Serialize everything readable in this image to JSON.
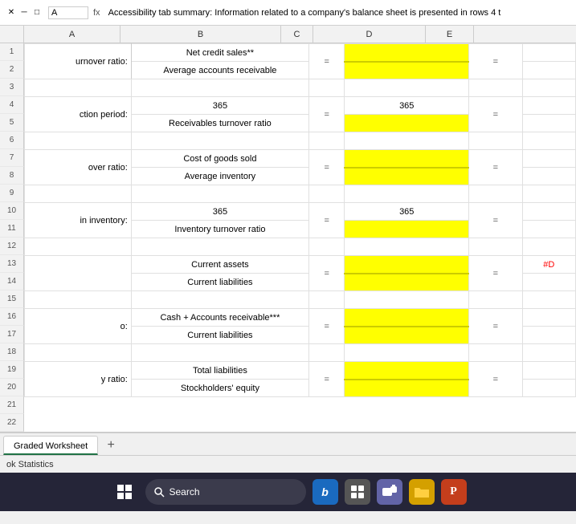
{
  "titlebar": {
    "close_btn": "✕",
    "min_btn": "─",
    "max_btn": "□",
    "name_box": "A",
    "fx_label": "fx",
    "formula": "Accessibility tab summary: Information related to a company's balance sheet is presented in rows 4 t"
  },
  "columns": {
    "headers": [
      "A",
      "B",
      "C",
      "D",
      "E"
    ]
  },
  "rows": [
    {
      "a": "urnover ratio:",
      "b_top": "Net credit sales**",
      "b_bot": "Average accounts receivable",
      "c": "=",
      "d_top_yellow": true,
      "d_bot_yellow": true,
      "e": "="
    },
    {
      "a": "ction period:",
      "b_top": "365",
      "b_bot": "Receivables turnover ratio",
      "c": "=",
      "d_top": "365",
      "d_bot_yellow": true,
      "e": "="
    },
    {
      "a": "over ratio:",
      "b_top": "Cost of goods sold",
      "b_bot": "Average inventory",
      "c": "=",
      "d_top_yellow": true,
      "d_bot_yellow": true,
      "e": "="
    },
    {
      "a": "in inventory:",
      "b_top": "365",
      "b_bot": "Inventory turnover ratio",
      "c": "=",
      "d_top": "365",
      "d_bot_yellow": true,
      "e": "="
    },
    {
      "a": "",
      "b_top": "Current assets",
      "b_bot": "Current liabilities",
      "c": "=",
      "d_top_yellow": true,
      "d_bot_yellow": true,
      "e": "=",
      "f": "#D"
    },
    {
      "a": "o:",
      "b_top": "Cash + Accounts receivable***",
      "b_bot": "Current liabilities",
      "c": "=",
      "d_top_yellow": true,
      "d_bot_yellow": true,
      "e": "="
    },
    {
      "a": "y ratio:",
      "b_top": "Total liabilities",
      "b_bot": "Stockholders' equity",
      "c": "=",
      "d_top_yellow": true,
      "d_bot_yellow": true,
      "e": "="
    }
  ],
  "tabs": {
    "active": "Graded Worksheet",
    "add_label": "+"
  },
  "statusbar": {
    "text": "ok Statistics"
  },
  "taskbar": {
    "windows_icon": "⊞",
    "search_placeholder": "Search",
    "bing_icon": "b",
    "desktop_icon": "▣",
    "teams_icon": "■",
    "files_icon": "📁",
    "ppt_icon": "P"
  }
}
